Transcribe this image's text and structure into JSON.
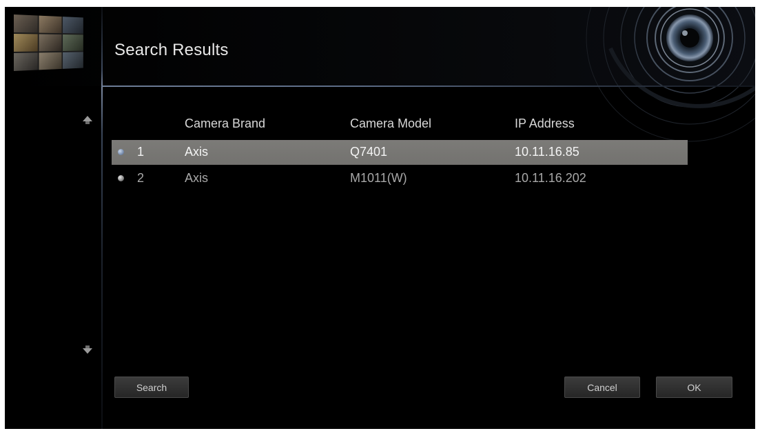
{
  "header": {
    "title": "Search Results"
  },
  "table": {
    "columns": [
      "Camera Brand",
      "Camera Model",
      "IP Address"
    ],
    "rows": [
      {
        "index": "1",
        "brand": "Axis",
        "model": "Q7401",
        "ip": "10.11.16.85",
        "selected": true
      },
      {
        "index": "2",
        "brand": "Axis",
        "model": "M1011(W)",
        "ip": "10.11.16.202",
        "selected": false
      }
    ]
  },
  "buttons": {
    "search": "Search",
    "cancel": "Cancel",
    "ok": "OK"
  },
  "icons": {
    "scroll_up": "scroll-up-arrow-icon",
    "scroll_down": "scroll-down-arrow-icon",
    "lens": "camera-lens-icon"
  },
  "colors": {
    "selected_row": "#7c7b78",
    "accent_line": "#6e7e98",
    "background": "#000000"
  }
}
